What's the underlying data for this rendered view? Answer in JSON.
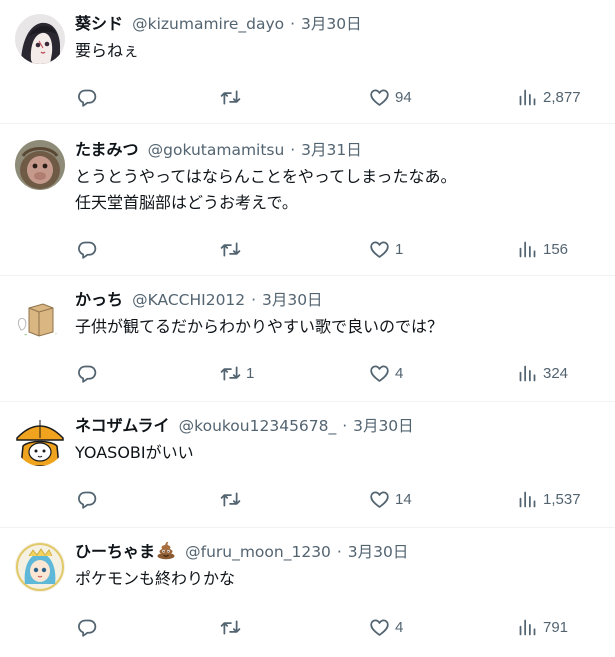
{
  "tweets": [
    {
      "name": "葵シド",
      "handle": "@kizumamire_dayo",
      "date": "3月30日",
      "text": [
        "要らねぇ"
      ],
      "reply_count": "",
      "retweet_count": "",
      "like_count": "94",
      "view_count": "2,877"
    },
    {
      "name": "たまみつ",
      "handle": "@gokutamamitsu",
      "date": "3月31日",
      "text": [
        "とうとうやってはならんことをやってしまったなあ。",
        "任天堂首脳部はどうお考えで。"
      ],
      "reply_count": "",
      "retweet_count": "",
      "like_count": "1",
      "view_count": "156"
    },
    {
      "name": "かっち",
      "handle": "@KACCHI2012",
      "date": "3月30日",
      "text": [
        "子供が観てるだからわかりやすい歌で良いのでは？"
      ],
      "reply_count": "",
      "retweet_count": "1",
      "like_count": "4",
      "view_count": "324"
    },
    {
      "name": "ネコザムライ",
      "handle": "@koukou12345678_",
      "date": "3月30日",
      "text": [
        "YOASOBIがいい"
      ],
      "reply_count": "",
      "retweet_count": "",
      "like_count": "14",
      "view_count": "1,537"
    },
    {
      "name": "ひーちゃま",
      "name_emoji": "poop-emoji",
      "handle": "@furu_moon_1230",
      "date": "3月30日",
      "text": [
        "ポケモンも終わりかな"
      ],
      "reply_count": "",
      "retweet_count": "",
      "like_count": "4",
      "view_count": "791"
    }
  ],
  "separator": "·",
  "icons": {
    "reply": "reply-icon",
    "retweet": "retweet-icon",
    "like": "heart-icon",
    "views": "views-chart-icon"
  },
  "colors": {
    "text_primary": "#0f1419",
    "text_secondary": "#536471",
    "divider": "#eff3f4"
  }
}
